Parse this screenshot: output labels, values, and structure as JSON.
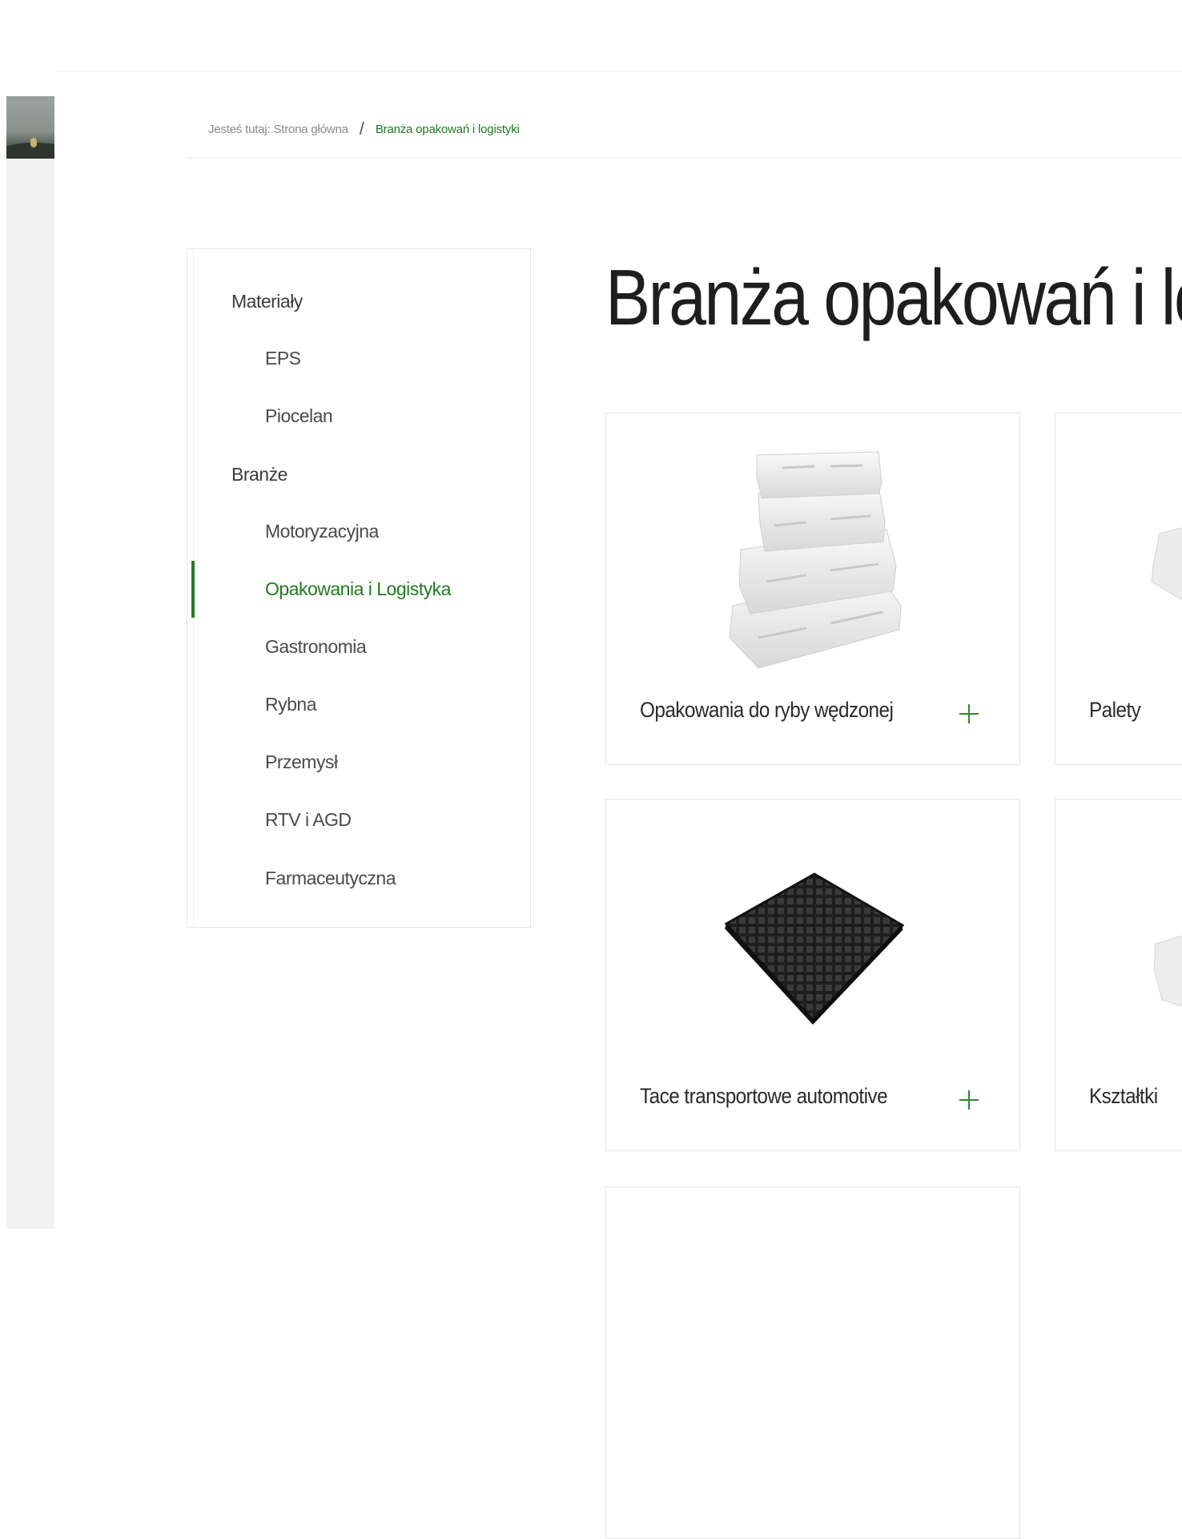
{
  "breadcrumb": {
    "prefix": "Jesteś tutaj:",
    "home": "Strona główna",
    "separator": "/",
    "current": "Branża opakowań i logistyki"
  },
  "page": {
    "title": "Branża opakowań i logistyki"
  },
  "sidebar": {
    "items": [
      {
        "label": "Materiały",
        "level": 1
      },
      {
        "label": "EPS",
        "level": 2
      },
      {
        "label": "Piocelan",
        "level": 2
      },
      {
        "label": "Branże",
        "level": 1
      },
      {
        "label": "Motoryzacyjna",
        "level": 2
      },
      {
        "label": "Opakowania i Logistyka",
        "level": 2,
        "active": true
      },
      {
        "label": "Gastronomia",
        "level": 2
      },
      {
        "label": "Rybna",
        "level": 2
      },
      {
        "label": "Przemysł",
        "level": 2
      },
      {
        "label": "RTV i AGD",
        "level": 2
      },
      {
        "label": "Farmaceutyczna",
        "level": 2
      }
    ]
  },
  "products": [
    {
      "label": "Opakowania do ryby wędzonej",
      "icon": "plus-icon",
      "image": "stacked-white-boxes"
    },
    {
      "label": "Palety",
      "icon": "plus-icon",
      "image": "white-pallet"
    },
    {
      "label": "Tace transportowe automotive",
      "icon": "plus-icon",
      "image": "black-tray"
    },
    {
      "label": "Kształtki",
      "icon": "plus-icon",
      "image": "white-shape"
    }
  ],
  "colors": {
    "accent": "#1f7a20",
    "text": "#222222",
    "border": "#e4e4e4",
    "sidebar_bg": "#f1f1f1"
  }
}
